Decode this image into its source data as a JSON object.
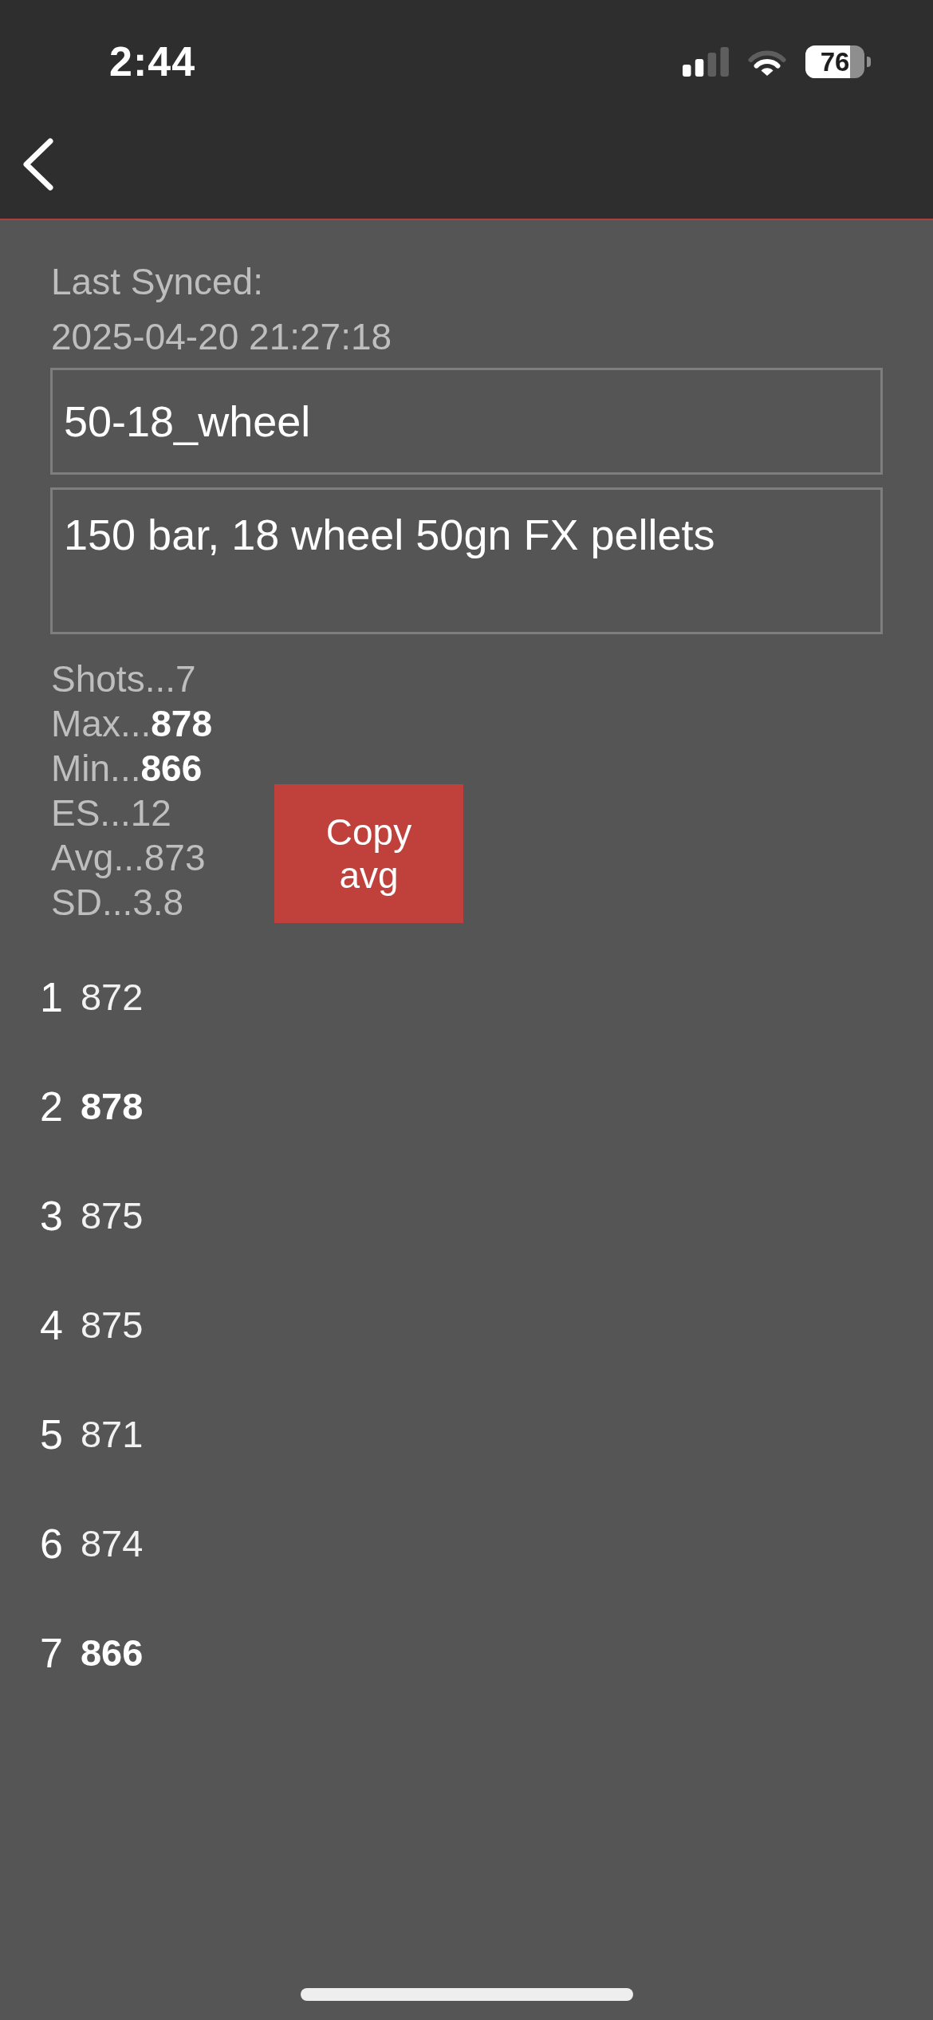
{
  "status_bar": {
    "time": "2:44",
    "battery": "76"
  },
  "sync": {
    "label": "Last Synced:",
    "timestamp": "2025-04-20 21:27:18"
  },
  "fields": [
    {
      "kind": "single",
      "value": "50-18_wheel"
    },
    {
      "kind": "multiline",
      "value": "150 bar, 18 wheel 50gn FX pellets"
    }
  ],
  "stats": [
    "Shots...7",
    "Max...**878**",
    "Min...**866**",
    "ES...12",
    "Avg...873",
    "SD...3.8"
  ],
  "copy_button": {
    "label": "Copy avg"
  },
  "shots": [
    {
      "number": "1",
      "value": "872",
      "highlighted": false
    },
    {
      "number": "2",
      "value": "878",
      "highlighted": true
    },
    {
      "number": "3",
      "value": "875",
      "highlighted": false
    },
    {
      "number": "4",
      "value": "875",
      "highlighted": false
    },
    {
      "number": "5",
      "value": "871",
      "highlighted": false
    },
    {
      "number": "6",
      "value": "874",
      "highlighted": false
    },
    {
      "number": "7",
      "value": "866",
      "highlighted": true
    }
  ]
}
